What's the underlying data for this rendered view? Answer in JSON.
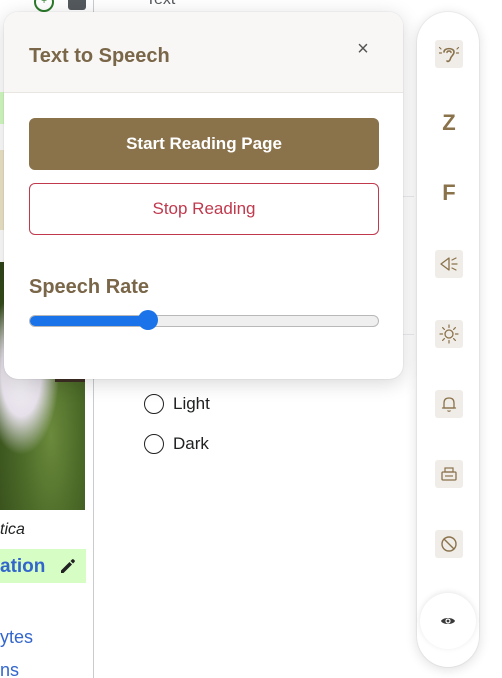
{
  "background_page": {
    "header_text": "Text",
    "caption": "tica",
    "edit_link": "ation",
    "link_1": "ytes",
    "link_2": "ns",
    "theme_options": [
      {
        "label": "Light"
      },
      {
        "label": "Dark"
      }
    ]
  },
  "tts_panel": {
    "title": "Text to Speech",
    "close_glyph": "×",
    "start_button": "Start Reading Page",
    "stop_button": "Stop Reading",
    "rate_label": "Speech Rate",
    "rate_fraction": 0.34
  },
  "toolbar": {
    "items": [
      {
        "icon": "ear-icon"
      },
      {
        "icon": "letter-z",
        "letter": "Z"
      },
      {
        "icon": "letter-f",
        "letter": "F"
      },
      {
        "icon": "megaphone-icon"
      },
      {
        "icon": "brightness-icon"
      },
      {
        "icon": "bell-icon"
      },
      {
        "icon": "print-icon"
      },
      {
        "icon": "block-icon"
      }
    ],
    "eye_icon": "eye-icon"
  },
  "colors": {
    "brand_brown": "#8a724b",
    "title_brown": "#7a6648",
    "stop_red": "#c0394d",
    "slider_blue": "#1a73e8",
    "link_blue": "#3366cc",
    "edit_green": "#d5fdc4"
  }
}
